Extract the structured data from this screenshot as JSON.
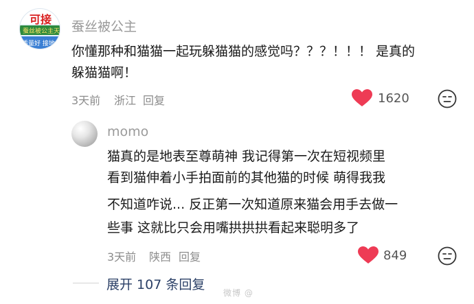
{
  "comment": {
    "username": "蚕丝被公主",
    "avatar_text": {
      "top": "可接",
      "middle": "蚕丝被公主天",
      "bottom": "质量好  接地"
    },
    "text_line1": "你懂那种和猫猫一起玩躲猫猫的感觉吗？？？！！！ 是真的",
    "text_line2": "躲猫猫啊！",
    "time": "3天前",
    "location": "浙江",
    "reply_label": "回复",
    "like_count": "1620"
  },
  "reply": {
    "username": "momo",
    "text_lines": [
      "猫真的是地表至尊萌神 我记得第一次在短视频里",
      "看到猫伸着小手拍面前的其他猫的时候 萌得我我",
      "不知道咋说... 反正第一次知道原来猫会用手去做一",
      "些事 这就比只会用嘴拱拱拱看起来聪明多了"
    ],
    "time": "3天前",
    "location": "陕西",
    "reply_label": "回复",
    "like_count": "849"
  },
  "expand_label": "展开 107 条回复",
  "watermark": "微博 @",
  "colors": {
    "heart": "#ee3b55",
    "expand_text": "#2a3f66",
    "meta": "#8c8c8c"
  },
  "icons": [
    "heart-icon",
    "dislike-face-icon"
  ]
}
